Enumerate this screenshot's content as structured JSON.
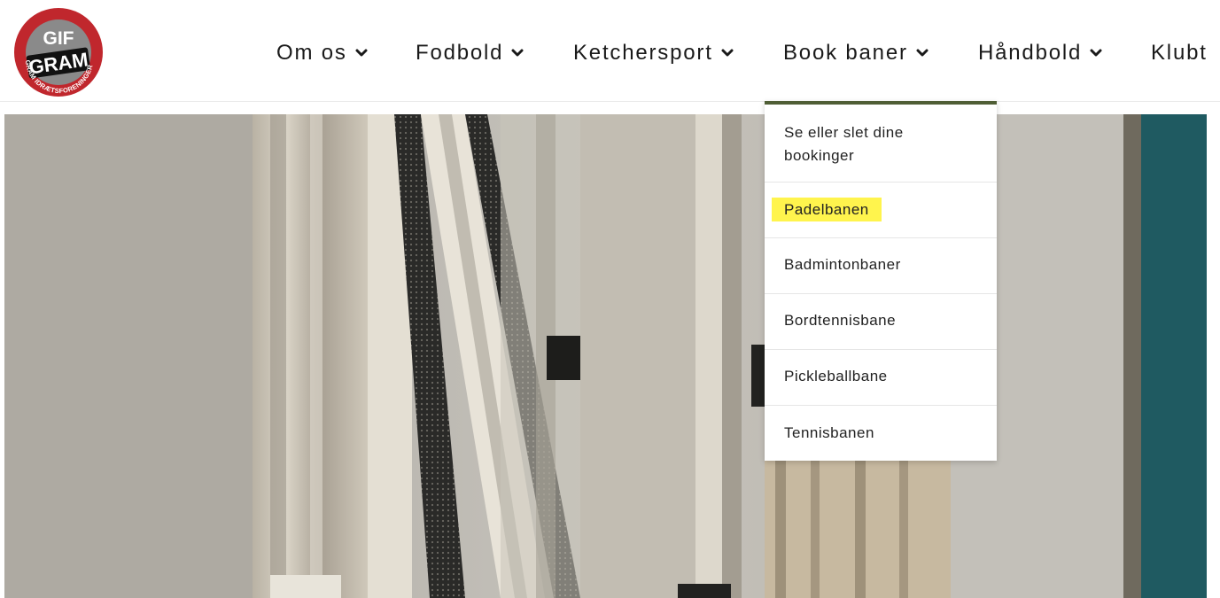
{
  "logo": {
    "top_text": "GIF",
    "main_text": "GRAM",
    "ring_text": "GRAM IDRÆTSFORENINGER",
    "colors": {
      "ring": "#c0272d",
      "center": "#8a8a8a"
    }
  },
  "nav": {
    "items": [
      {
        "label": "Om os",
        "icon": "chevron-down-icon"
      },
      {
        "label": "Fodbold",
        "icon": "chevron-down-icon"
      },
      {
        "label": "Ketchersport",
        "icon": "chevron-down-icon"
      },
      {
        "label": "Book baner",
        "icon": "chevron-down-icon",
        "active": true
      },
      {
        "label": "Håndbold",
        "icon": "chevron-down-icon"
      },
      {
        "label": "Klubt"
      }
    ]
  },
  "dropdown": {
    "accent_color": "#4f5e35",
    "items": [
      {
        "label": "Se eller slet dine bookinger"
      },
      {
        "label": "Padelbanen",
        "highlighted": true,
        "highlight_color": "#fff44d"
      },
      {
        "label": "Badmintonbaner"
      },
      {
        "label": "Bordtennisbane"
      },
      {
        "label": "Pickleballbane"
      },
      {
        "label": "Tennisbanen"
      }
    ]
  }
}
